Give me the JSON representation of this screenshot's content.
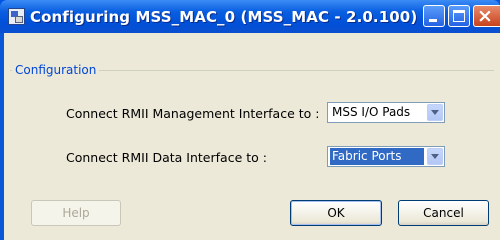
{
  "window": {
    "title": "Configuring MSS_MAC_0 (MSS_MAC - 2.0.100)"
  },
  "configuration": {
    "group_label": "Configuration",
    "management_label": "Connect RMII Management Interface to :",
    "management_value": "MSS I/O Pads",
    "data_label": "Connect RMII Data Interface to :",
    "data_value": "Fabric Ports"
  },
  "buttons": {
    "help": "Help",
    "ok": "OK",
    "cancel": "Cancel",
    "close_glyph": "×"
  },
  "colors": {
    "titlebar": "#0054e3",
    "dialog_bg": "#ece9d8",
    "group_label": "#0046d5",
    "selection": "#316ac5"
  }
}
